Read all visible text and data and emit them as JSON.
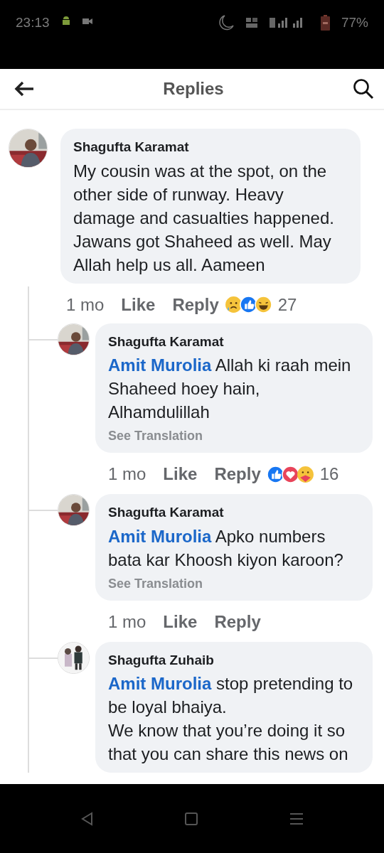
{
  "status_bar": {
    "time": "23:13",
    "battery": "77%"
  },
  "header": {
    "title": "Replies"
  },
  "comment": {
    "author": "Shagufta Karamat",
    "text": "My cousin was at the spot, on the other side of runway. Heavy damage and casualties happened. Jawans got Shaheed as well. May Allah help us all. Aameen",
    "time": "1 mo",
    "actions": [
      "Like",
      "Reply"
    ],
    "reactions": [
      {
        "kind": "sad"
      },
      {
        "kind": "like"
      },
      {
        "kind": "haha"
      }
    ],
    "reaction_count": "27",
    "replies": [
      {
        "author": "Shagufta Karamat",
        "mention": "Amit Murolia",
        "text": "Allah ki raah mein Shaheed hoey hain, Alhamdulillah",
        "translation_link": "See Translation",
        "time": "1 mo",
        "actions": [
          "Like",
          "Reply"
        ],
        "reactions": [
          {
            "kind": "like"
          },
          {
            "kind": "love"
          },
          {
            "kind": "care"
          }
        ],
        "reaction_count": "16"
      },
      {
        "author": "Shagufta Karamat",
        "mention": "Amit Murolia",
        "text": "Apko numbers bata kar Khoosh kiyon karoon?",
        "translation_link": "See Translation",
        "time": "1 mo",
        "actions": [
          "Like",
          "Reply"
        ]
      },
      {
        "author": "Shagufta Zuhaib",
        "mention": "Amit Murolia",
        "text": "stop pretending to be loyal bhaiya.\nWe know that you’re doing it so that you can share this news on"
      }
    ]
  }
}
